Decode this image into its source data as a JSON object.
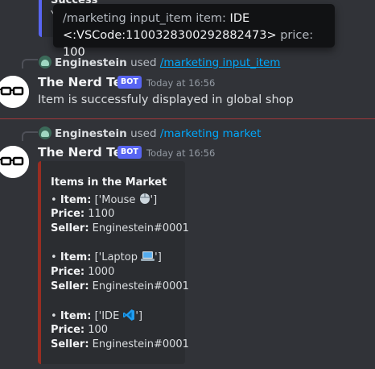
{
  "top_embed": {
    "title": "Success",
    "fragment": "Y"
  },
  "tooltip": {
    "line1_prefix": "/marketing input_item item: ",
    "line1_value": "IDE",
    "line2_value": "<:VSCode:1100328300292882473>",
    "line2_key": " price: ",
    "line2_price": "100"
  },
  "messages": [
    {
      "reply": {
        "user": "Enginestein",
        "used": "used",
        "command": "/marketing input_item"
      },
      "author": "The Nerd Test",
      "bot_tag": "BOT",
      "timestamp": "Today at 16:56",
      "content": "Item is successfuly displayed in global shop"
    },
    {
      "reply": {
        "user": "Enginestein",
        "used": "used",
        "command": "/marketing market"
      },
      "author": "The Nerd Test",
      "bot_tag": "BOT",
      "timestamp": "Today at 16:56",
      "embed": {
        "title": "Items in the Market",
        "item_label": "Item:",
        "price_label": "Price:",
        "seller_label": "Seller:",
        "items": [
          {
            "item_open": "['Mouse ",
            "item_close": "']",
            "emoji": "computer-mouse-icon",
            "price": "1100",
            "seller": "Enginestein#0001"
          },
          {
            "item_open": "['Laptop ",
            "item_close": "']",
            "emoji": "laptop-icon",
            "price": "1000",
            "seller": "Enginestein#0001"
          },
          {
            "item_open": "['IDE ",
            "item_close": "']",
            "emoji": "vscode-icon",
            "price": "100",
            "seller": "Enginestein#0001"
          }
        ]
      }
    }
  ],
  "colors": {
    "background": "#313338",
    "embed_background": "#2b2d31",
    "embed_accent": "#992d22",
    "bot_tag": "#5865f2",
    "link": "#00a8fc",
    "new_divider": "#a1373b"
  }
}
